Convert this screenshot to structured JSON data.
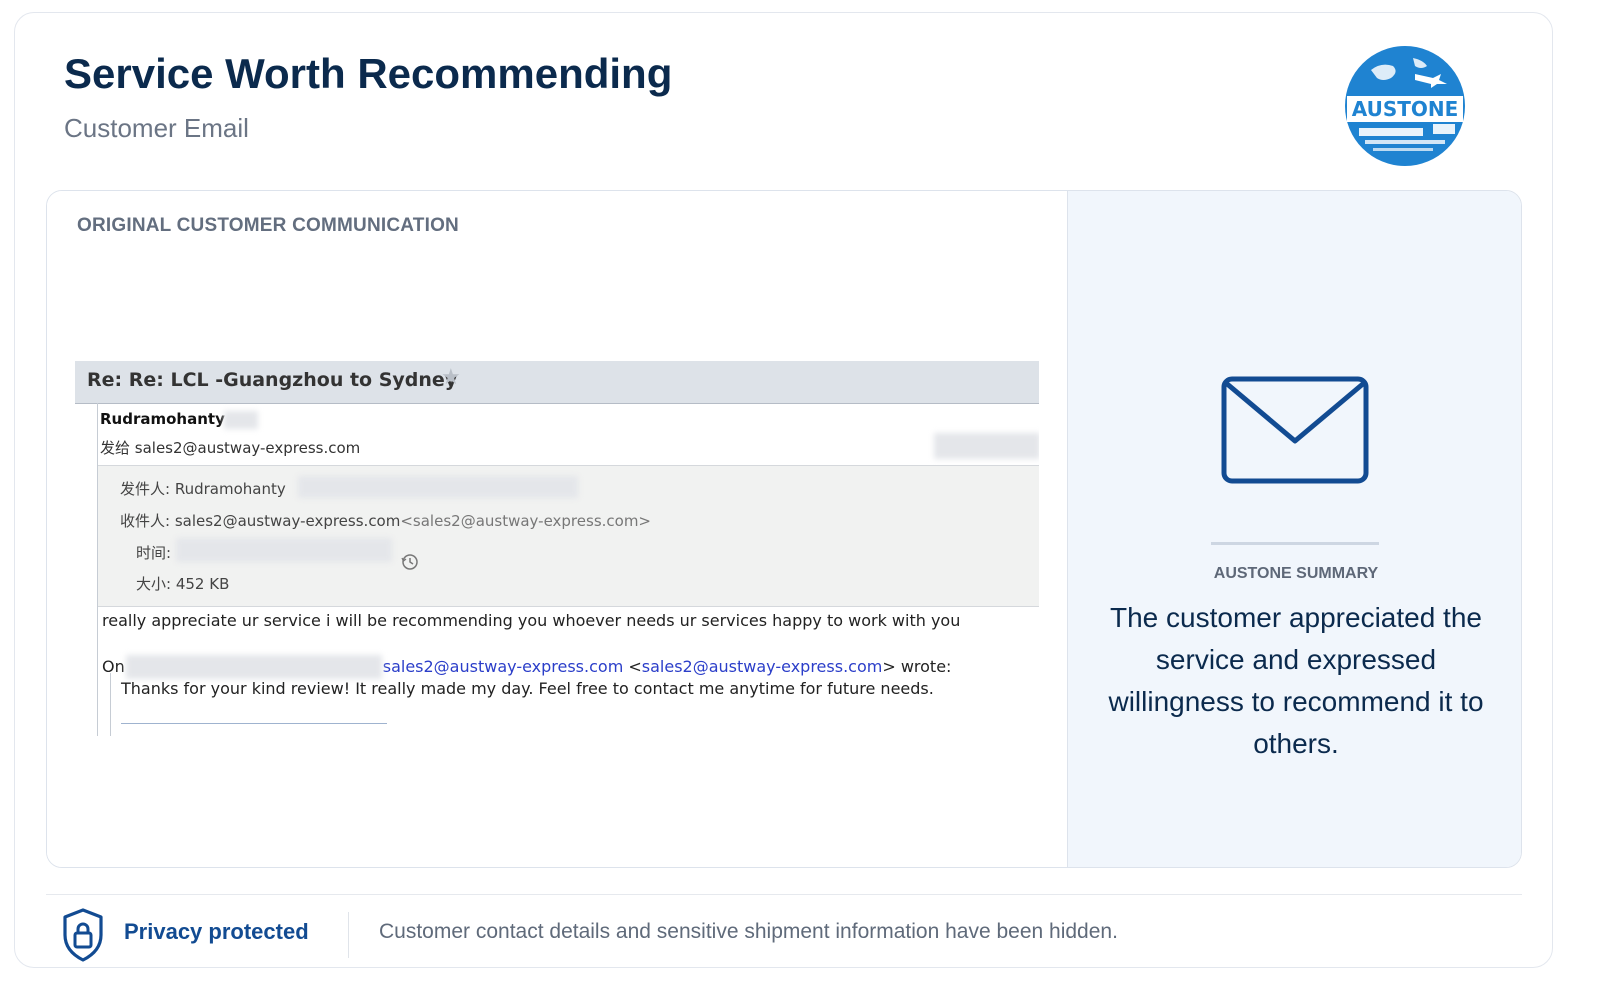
{
  "header": {
    "title": "Service Worth Recommending",
    "subtitle": "Customer Email",
    "logo_text": "AUSTONE"
  },
  "left_panel": {
    "section_label": "ORIGINAL CUSTOMER COMMUNICATION",
    "email": {
      "subject": "Re: Re: LCL -Guangzhou to Sydney",
      "sender_name": "Rudramohanty",
      "to_line": "发给 sales2@austway-express.com",
      "meta": {
        "from_label": "发件人:",
        "from_value": "Rudramohanty",
        "to_label": "收件人:",
        "to_value": "sales2@austway-express.com",
        "to_value_bracket": "<sales2@austway-express.com>",
        "time_label": "时间:",
        "size_label": "大小:",
        "size_value": "452 KB"
      },
      "message": "really appreciate ur service i will be recommending you whoever needs ur services happy to work with you",
      "quote_header": {
        "on": "On",
        "link_1": "sales2@austway-express.com",
        "link_2": "sales2@austway-express.com",
        "lt": "<",
        "suffix": "> wrote:"
      },
      "quote_text": "Thanks for your kind review! It really made my day. Feel free to contact me anytime for future needs."
    }
  },
  "right_panel": {
    "summary_label": "AUSTONE SUMMARY",
    "summary_text": "The customer appreciated the service and expressed willingness to recommend it to others."
  },
  "footer": {
    "privacy_label": "Privacy protected",
    "privacy_note": "Customer contact details and sensitive shipment information have been hidden."
  },
  "colors": {
    "brand_navy": "#0b2a4d",
    "brand_blue": "#124b92",
    "logo_blue": "#1f83d1",
    "summary_bg": "#f1f6fc"
  },
  "icons": [
    "austone-logo-icon",
    "star-icon",
    "history-icon",
    "envelope-icon",
    "shield-lock-icon"
  ]
}
